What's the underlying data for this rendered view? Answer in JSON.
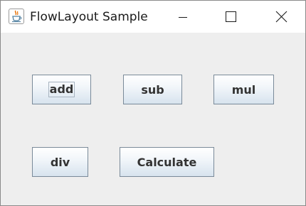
{
  "window": {
    "title": "FlowLayout Sample",
    "icon": "java-cup-icon",
    "controls": [
      "minimize-icon",
      "maximize-icon",
      "close-icon"
    ]
  },
  "buttons": {
    "add": "add",
    "sub": "sub",
    "mul": "mul",
    "div": "div",
    "calculate": "Calculate"
  },
  "colors": {
    "window_background": "#eeeeee",
    "titlebar_background": "#ffffff",
    "button_border": "#7a8a99",
    "button_text": "#333333",
    "cup_icon": "#e76f00"
  }
}
